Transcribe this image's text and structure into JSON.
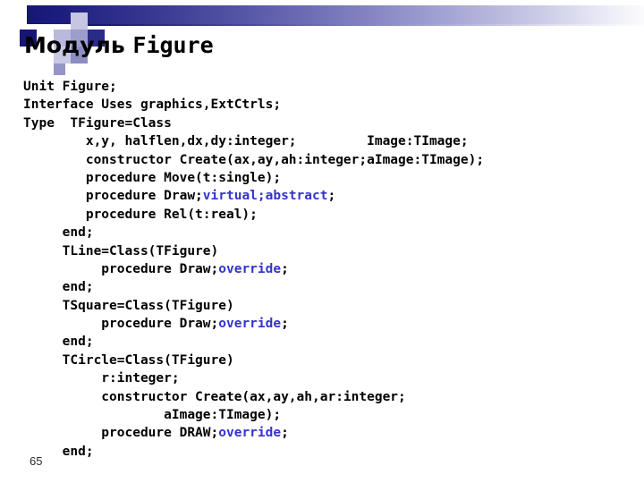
{
  "slide": {
    "title": {
      "cyrillic_part": "Модуль",
      "mono_part": "Figure",
      "full": "Модуль Figure"
    },
    "number": "65",
    "accent_color": "#161675",
    "keyword_color": "#3333cc",
    "background_color": "#ffffff",
    "text_color": "#000000"
  },
  "code": {
    "language": "pascal",
    "lines": [
      {
        "indent": 0,
        "segments": [
          {
            "text": "Unit Figure;",
            "kind": "plain"
          }
        ]
      },
      {
        "indent": 0,
        "segments": [
          {
            "text": "Interface Uses graphics,ExtCtrls;",
            "kind": "plain"
          }
        ]
      },
      {
        "indent": 0,
        "segments": [
          {
            "text": "Type  TFigure=Class",
            "kind": "plain"
          }
        ]
      },
      {
        "indent": 0,
        "segments": [
          {
            "text": "        x,y, halflen,dx,dy:integer;         Image:TImage;",
            "kind": "plain"
          }
        ]
      },
      {
        "indent": 0,
        "segments": [
          {
            "text": "        constructor Create(ax,ay,ah:integer;aImage:TImage);",
            "kind": "plain"
          }
        ]
      },
      {
        "indent": 0,
        "segments": [
          {
            "text": "        procedure Move(t:single);",
            "kind": "plain"
          }
        ]
      },
      {
        "indent": 0,
        "segments": [
          {
            "text": "        procedure Draw;",
            "kind": "plain"
          },
          {
            "text": "virtual;abstract",
            "kind": "keyword"
          },
          {
            "text": ";",
            "kind": "plain"
          }
        ]
      },
      {
        "indent": 0,
        "segments": [
          {
            "text": "        procedure Rel(t:real);",
            "kind": "plain"
          }
        ]
      },
      {
        "indent": 0,
        "segments": [
          {
            "text": "     end;",
            "kind": "plain"
          }
        ]
      },
      {
        "indent": 0,
        "segments": [
          {
            "text": "     TLine=Class(TFigure)",
            "kind": "plain"
          }
        ]
      },
      {
        "indent": 0,
        "segments": [
          {
            "text": "          procedure Draw;",
            "kind": "plain"
          },
          {
            "text": "override",
            "kind": "keyword"
          },
          {
            "text": ";",
            "kind": "plain"
          }
        ]
      },
      {
        "indent": 0,
        "segments": [
          {
            "text": "     end;",
            "kind": "plain"
          }
        ]
      },
      {
        "indent": 0,
        "segments": [
          {
            "text": "     TSquare=Class(TFigure)",
            "kind": "plain"
          }
        ]
      },
      {
        "indent": 0,
        "segments": [
          {
            "text": "          procedure Draw;",
            "kind": "plain"
          },
          {
            "text": "override",
            "kind": "keyword"
          },
          {
            "text": ";",
            "kind": "plain"
          }
        ]
      },
      {
        "indent": 0,
        "segments": [
          {
            "text": "     end;",
            "kind": "plain"
          }
        ]
      },
      {
        "indent": 0,
        "segments": [
          {
            "text": "     TCircle=Class(TFigure)",
            "kind": "plain"
          }
        ]
      },
      {
        "indent": 0,
        "segments": [
          {
            "text": "          r:integer;",
            "kind": "plain"
          }
        ]
      },
      {
        "indent": 0,
        "segments": [
          {
            "text": "          constructor Create(ax,ay,ah,ar:integer;",
            "kind": "plain"
          }
        ]
      },
      {
        "indent": 0,
        "segments": [
          {
            "text": "                  aImage:TImage);",
            "kind": "plain"
          }
        ]
      },
      {
        "indent": 0,
        "segments": [
          {
            "text": "          procedure DRAW;",
            "kind": "plain"
          },
          {
            "text": "override",
            "kind": "keyword"
          },
          {
            "text": ";",
            "kind": "plain"
          }
        ]
      },
      {
        "indent": 0,
        "segments": [
          {
            "text": "     end;",
            "kind": "plain"
          }
        ]
      }
    ]
  }
}
